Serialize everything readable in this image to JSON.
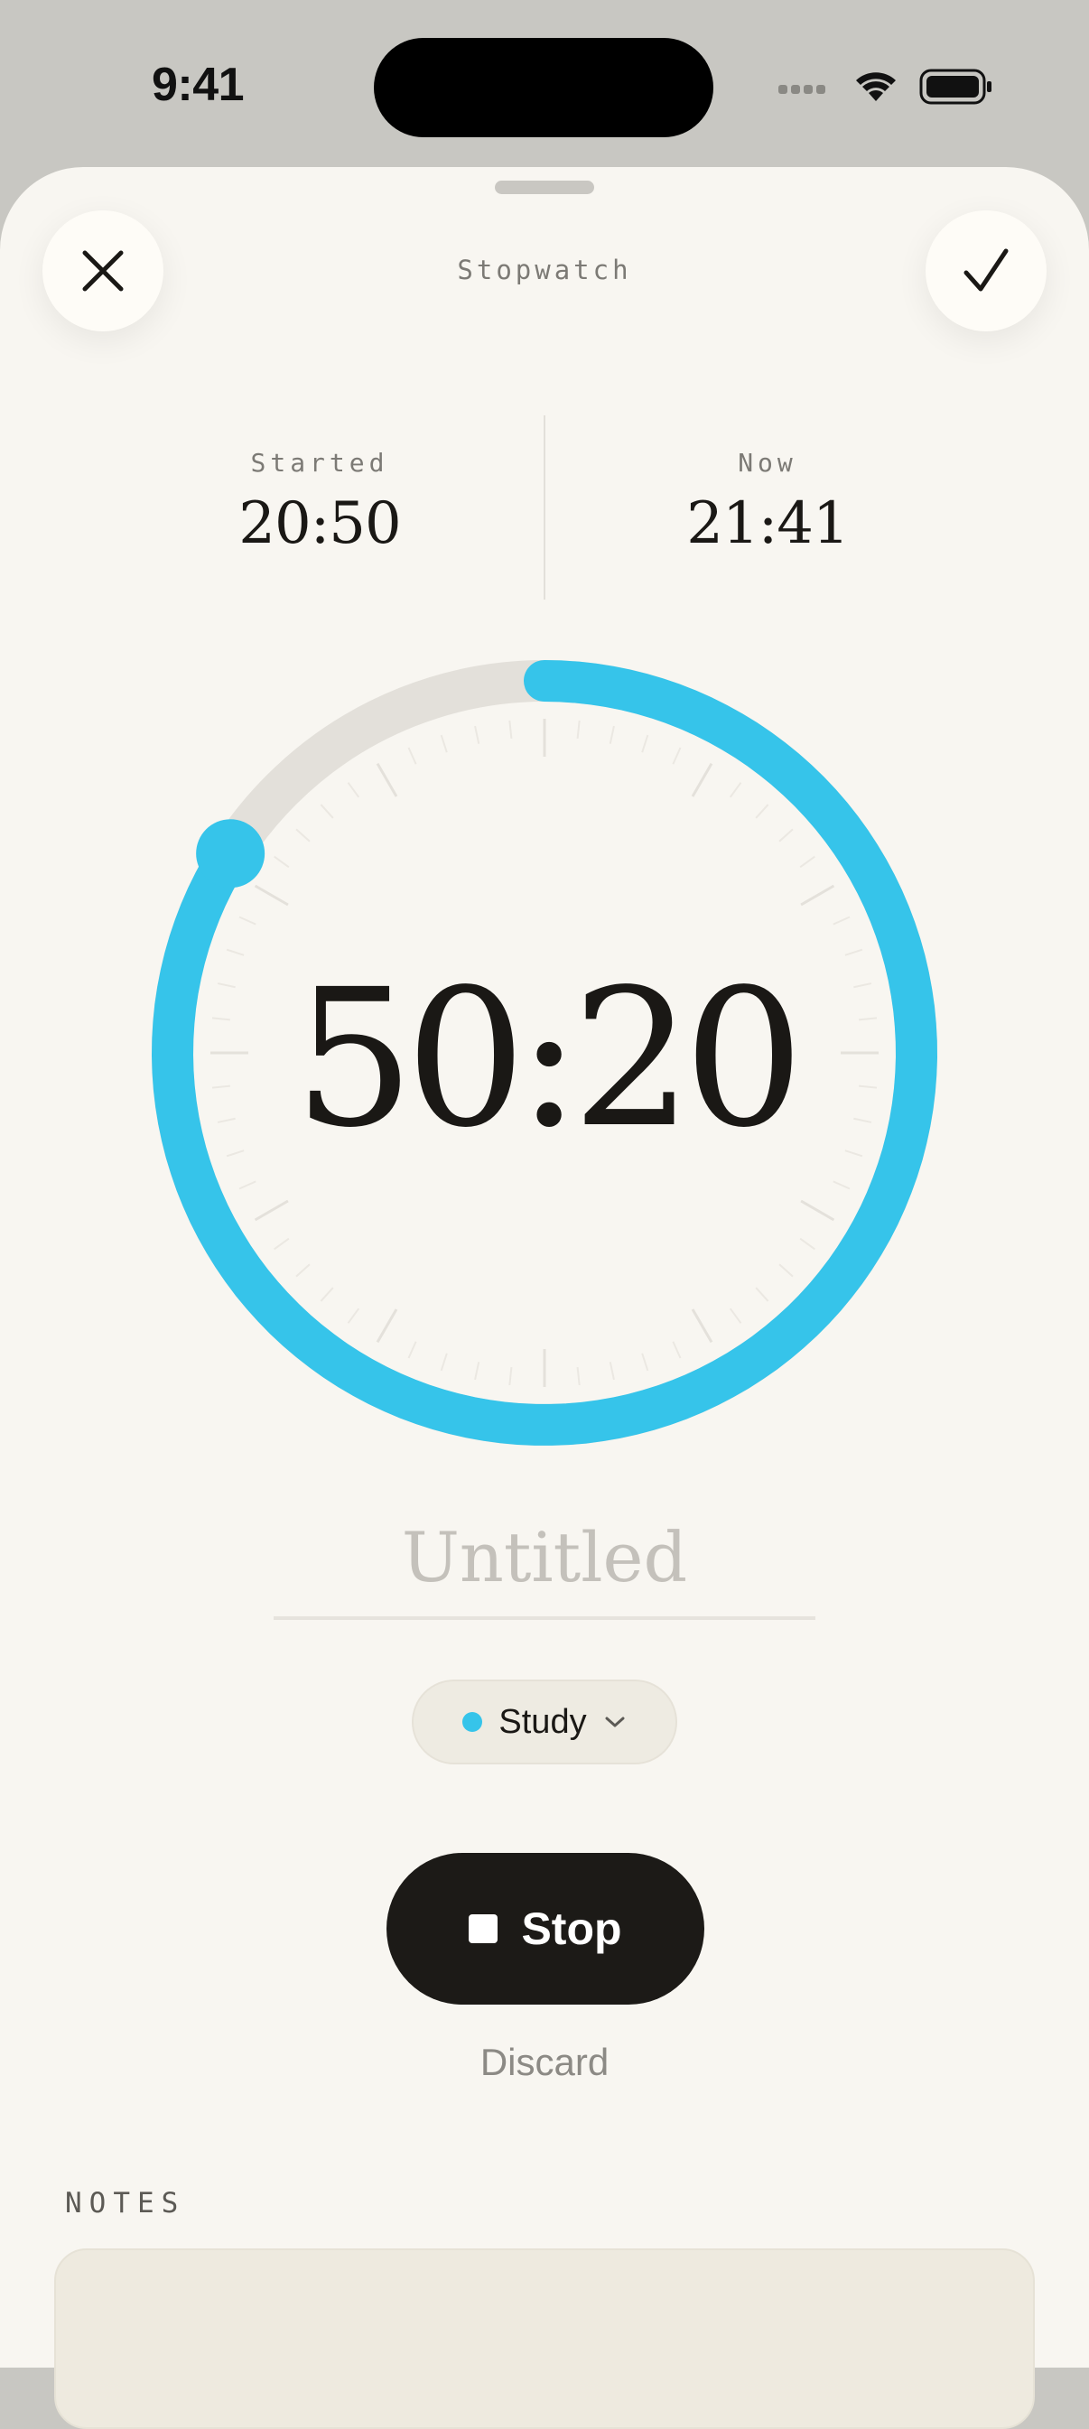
{
  "status_bar": {
    "time": "9:41"
  },
  "header": {
    "title": "Stopwatch",
    "close_icon": "close-icon",
    "confirm_icon": "checkmark-icon"
  },
  "times": {
    "started_label": "Started",
    "started_value": "20:50",
    "now_label": "Now",
    "now_value": "21:41"
  },
  "timer": {
    "elapsed": "50:20",
    "progress": 0.84
  },
  "session": {
    "title_placeholder": "Untitled",
    "category": "Study",
    "category_color": "#36c4ea"
  },
  "actions": {
    "stop_label": "Stop",
    "discard_label": "Discard"
  },
  "notes": {
    "label": "NOTES"
  },
  "colors": {
    "accent": "#36c4ea",
    "background": "#f8f6f1",
    "dark": "#1c1a17"
  }
}
